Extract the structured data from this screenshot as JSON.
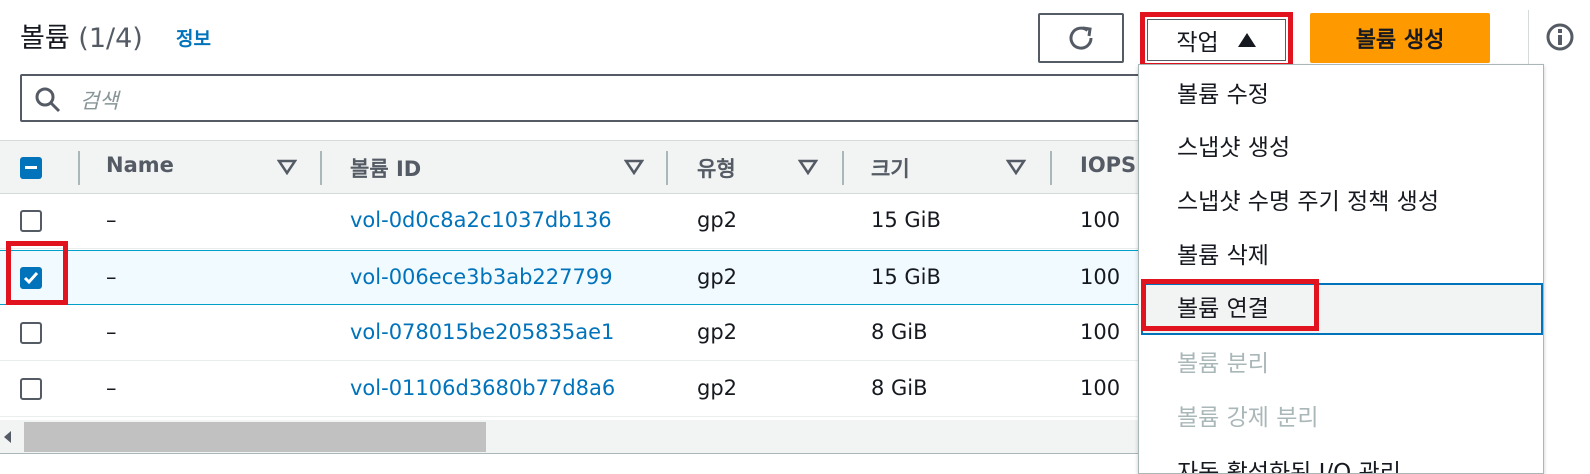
{
  "header": {
    "title": "볼륨",
    "count": "(1/4)",
    "info_link": "정보",
    "actions_label": "작업",
    "create_label": "볼륨 생성"
  },
  "search": {
    "placeholder": "검색"
  },
  "table": {
    "columns": [
      "Name",
      "볼륨 ID",
      "유형",
      "크기",
      "IOPS"
    ],
    "rows": [
      {
        "name": "–",
        "volume_id": "vol-0d0c8a2c1037db136",
        "type": "gp2",
        "size": "15 GiB",
        "iops": "100",
        "selected": false
      },
      {
        "name": "–",
        "volume_id": "vol-006ece3b3ab227799",
        "type": "gp2",
        "size": "15 GiB",
        "iops": "100",
        "selected": true
      },
      {
        "name": "–",
        "volume_id": "vol-078015be205835ae1",
        "type": "gp2",
        "size": "8 GiB",
        "iops": "100",
        "selected": false
      },
      {
        "name": "–",
        "volume_id": "vol-01106d3680b77d8a6",
        "type": "gp2",
        "size": "8 GiB",
        "iops": "100",
        "selected": false
      }
    ]
  },
  "actions_menu": {
    "items": [
      {
        "label": "볼륨 수정",
        "disabled": false
      },
      {
        "label": "스냅샷 생성",
        "disabled": false
      },
      {
        "label": "스냅샷 수명 주기 정책 생성",
        "disabled": false
      },
      {
        "label": "볼륨 삭제",
        "disabled": false
      },
      {
        "label": "볼륨 연결",
        "disabled": false
      },
      {
        "label": "볼륨 분리",
        "disabled": true
      },
      {
        "label": "볼륨 강제 분리",
        "disabled": true
      },
      {
        "label": "자동 활성화된 I/O 관리",
        "disabled": false
      }
    ]
  },
  "colors": {
    "accent": "#0073bb",
    "primary_button": "#ff9900",
    "highlight": "#e0131f"
  },
  "icons": {
    "refresh": "refresh-icon",
    "search": "search-icon",
    "info": "info-icon",
    "caret": "caret-up-icon",
    "sort": "sort-down-icon"
  }
}
